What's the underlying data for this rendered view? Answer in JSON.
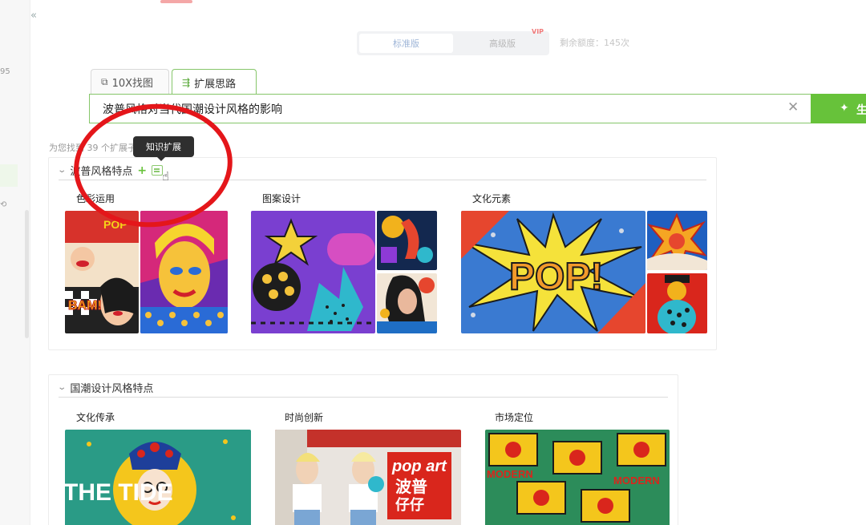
{
  "app": {
    "mode_tabs": [
      "标准版",
      "高级版"
    ],
    "vip_badge": "VIP",
    "remaining": "剩余额度：145次"
  },
  "tabs": [
    {
      "label": "10X找图",
      "icon": "image-search-icon"
    },
    {
      "label": "扩展思路",
      "icon": "branch-icon",
      "active": true
    }
  ],
  "search": {
    "value": "波普风格对当代国潮设计风格的影响",
    "button_label": "生"
  },
  "result_count": "为您找到 39 个扩展子",
  "tooltip": "知识扩展",
  "sections": [
    {
      "title": "波普风格特点",
      "subsections": [
        {
          "title": "色彩运用",
          "images": [
            "pop-comic-collage",
            "pop-portrait-dots"
          ]
        },
        {
          "title": "图案设计",
          "images": [
            "pop-abstract-shapes",
            "pop-pattern-1",
            "pop-woman-portrait"
          ]
        },
        {
          "title": "文化元素",
          "images": [
            "pop-burst-lettering",
            "pop-explosion",
            "pop-figure"
          ]
        }
      ]
    },
    {
      "title": "国潮设计风格特点",
      "subsections": [
        {
          "title": "文化传承",
          "images": [
            "the-tide-opera-mask"
          ]
        },
        {
          "title": "时尚创新",
          "images": [
            "pop-art-fashion-poster"
          ]
        },
        {
          "title": "市场定位",
          "images": [
            "modern-pattern-grid"
          ]
        }
      ]
    }
  ],
  "tile_text": {
    "pop_big": "POP!",
    "bam": "BAM!",
    "pop_small": "POP",
    "the_tide": "THE    TIDE",
    "pop_art": "pop art",
    "bopu": "波普",
    "wuzai": "仔仔",
    "modern": "MODERN"
  },
  "colors": {
    "accent_green": "#67c23a",
    "annotation_red": "#e4161a"
  }
}
